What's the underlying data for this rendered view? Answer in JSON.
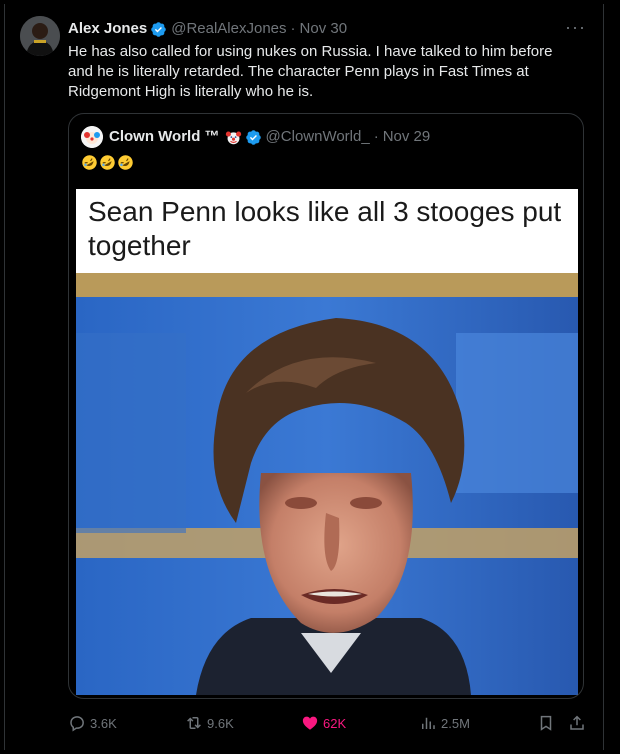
{
  "tweet": {
    "author_name": "Alex Jones",
    "handle": "@RealAlexJones",
    "separator": "·",
    "date": "Nov 30",
    "more_label": "···",
    "text": "He has also called for using nukes on Russia. I have talked to him before and he is literally retarded. The character Penn plays in Fast Times at Ridgemont High is literally who he is."
  },
  "quote": {
    "author_name": "Clown World ™",
    "handle": "@ClownWorld_",
    "separator": "·",
    "date": "Nov 29",
    "emoji_name": "rolling-on-floor-laughing-icon",
    "meme_caption": "Sean Penn looks like all 3 stooges put together"
  },
  "actions": {
    "replies": "3.6K",
    "reposts": "9.6K",
    "likes": "62K",
    "views": "2.5M"
  },
  "colors": {
    "background": "#000000",
    "text": "#e7e9ea",
    "muted": "#71767b",
    "verified": "#1d9bf0",
    "like": "#f91880",
    "border": "#2f3336"
  }
}
